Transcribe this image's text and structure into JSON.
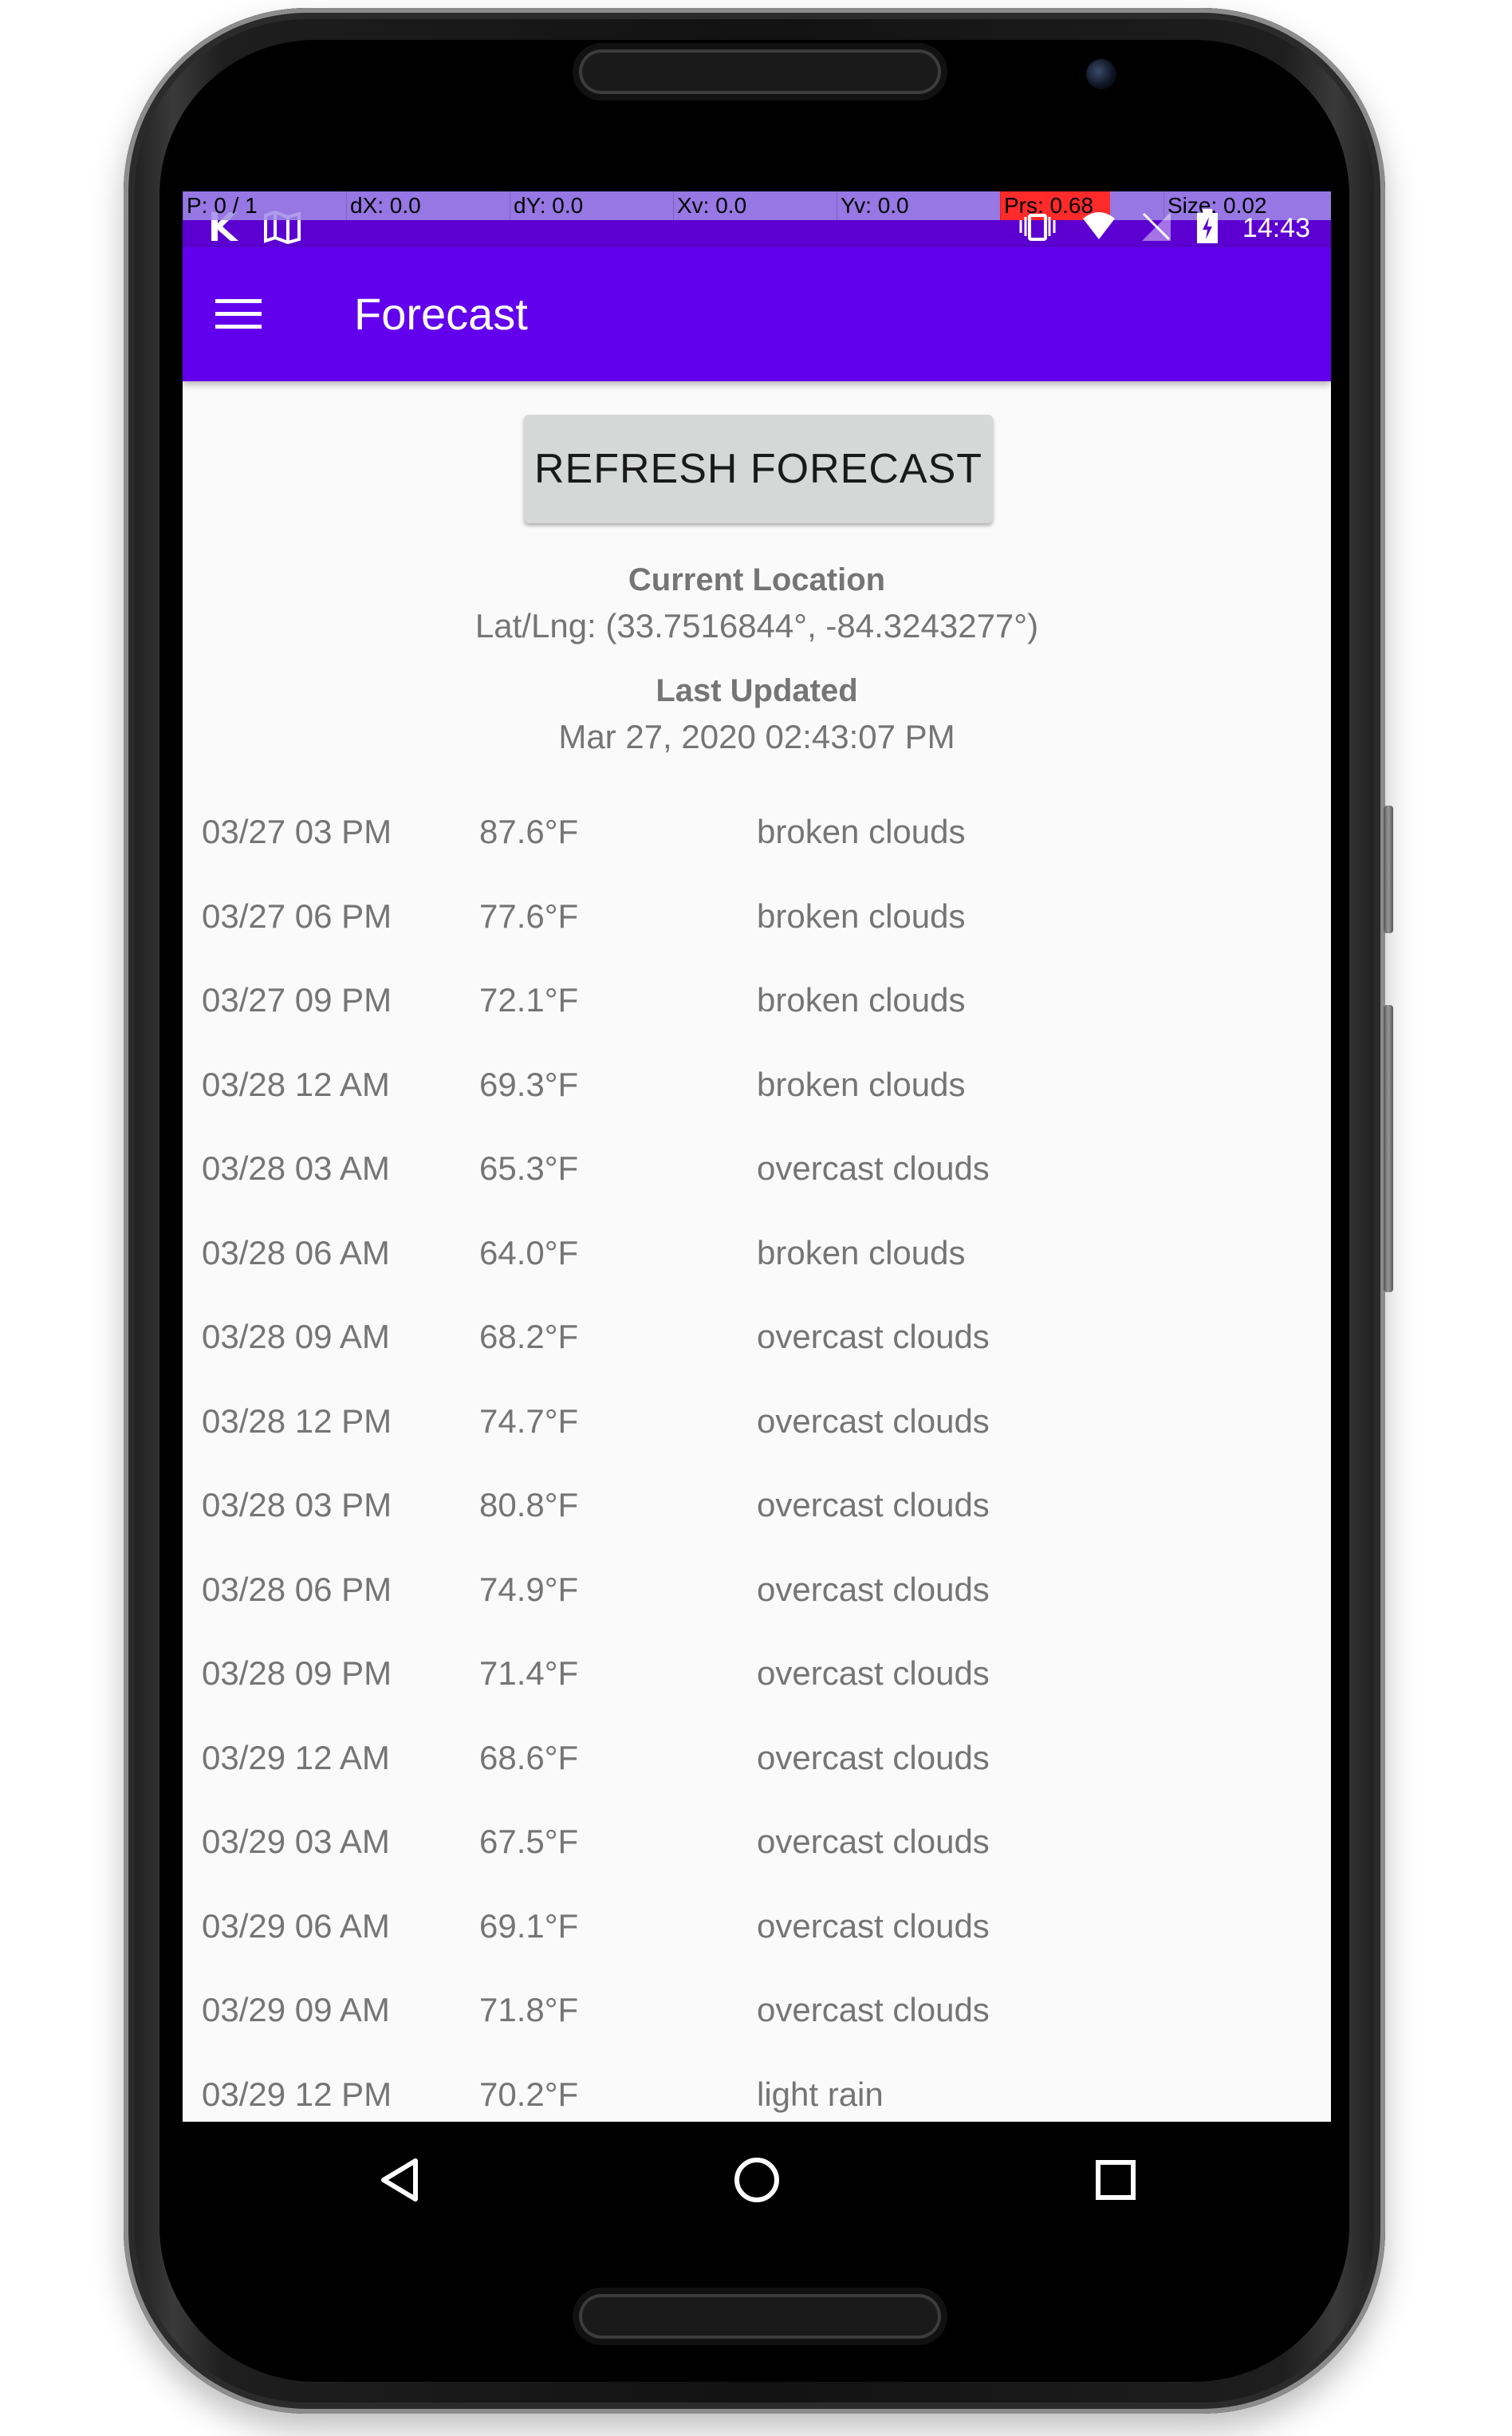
{
  "status_bar": {
    "pointer_overlay": {
      "p": "P: 0 / 1",
      "dx": "dX: 0.0",
      "dy": "dY: 0.0",
      "xv": "Xv: 0.0",
      "yv": "Yv: 0.0",
      "prs": "Prs: 0.68",
      "size": "Size: 0.02"
    },
    "time": "14:43",
    "left_icons": [
      "notification-k-icon",
      "map-icon"
    ],
    "right_icons": [
      "vibrate-icon",
      "wifi-icon",
      "no-signal-icon",
      "battery-charging-icon"
    ]
  },
  "app_bar": {
    "title": "Forecast",
    "menu_icon": "hamburger-menu-icon"
  },
  "refresh_button": {
    "label": "REFRESH FORECAST"
  },
  "location": {
    "label": "Current Location",
    "value": "Lat/Lng: (33.7516844°, -84.3243277°)"
  },
  "updated": {
    "label": "Last Updated",
    "value": "Mar 27, 2020 02:43:07 PM"
  },
  "forecast": [
    {
      "time": "03/27 03 PM",
      "temp": "87.6°F",
      "desc": "broken clouds"
    },
    {
      "time": "03/27 06 PM",
      "temp": "77.6°F",
      "desc": "broken clouds"
    },
    {
      "time": "03/27 09 PM",
      "temp": "72.1°F",
      "desc": "broken clouds"
    },
    {
      "time": "03/28 12 AM",
      "temp": "69.3°F",
      "desc": "broken clouds"
    },
    {
      "time": "03/28 03 AM",
      "temp": "65.3°F",
      "desc": "overcast clouds"
    },
    {
      "time": "03/28 06 AM",
      "temp": "64.0°F",
      "desc": "broken clouds"
    },
    {
      "time": "03/28 09 AM",
      "temp": "68.2°F",
      "desc": "overcast clouds"
    },
    {
      "time": "03/28 12 PM",
      "temp": "74.7°F",
      "desc": "overcast clouds"
    },
    {
      "time": "03/28 03 PM",
      "temp": "80.8°F",
      "desc": "overcast clouds"
    },
    {
      "time": "03/28 06 PM",
      "temp": "74.9°F",
      "desc": "overcast clouds"
    },
    {
      "time": "03/28 09 PM",
      "temp": "71.4°F",
      "desc": "overcast clouds"
    },
    {
      "time": "03/29 12 AM",
      "temp": "68.6°F",
      "desc": "overcast clouds"
    },
    {
      "time": "03/29 03 AM",
      "temp": "67.5°F",
      "desc": "overcast clouds"
    },
    {
      "time": "03/29 06 AM",
      "temp": "69.1°F",
      "desc": "overcast clouds"
    },
    {
      "time": "03/29 09 AM",
      "temp": "71.8°F",
      "desc": "overcast clouds"
    },
    {
      "time": "03/29 12 PM",
      "temp": "70.2°F",
      "desc": "light rain"
    }
  ],
  "nav_bar": {
    "back_icon": "back-triangle-icon",
    "home_icon": "home-circle-icon",
    "recents_icon": "recents-square-icon"
  },
  "colors": {
    "app_bar": "#6200ee",
    "status_bar": "#5c00d2",
    "background": "#fafafa",
    "text_secondary": "#757575",
    "button": "#d6d7d7"
  }
}
